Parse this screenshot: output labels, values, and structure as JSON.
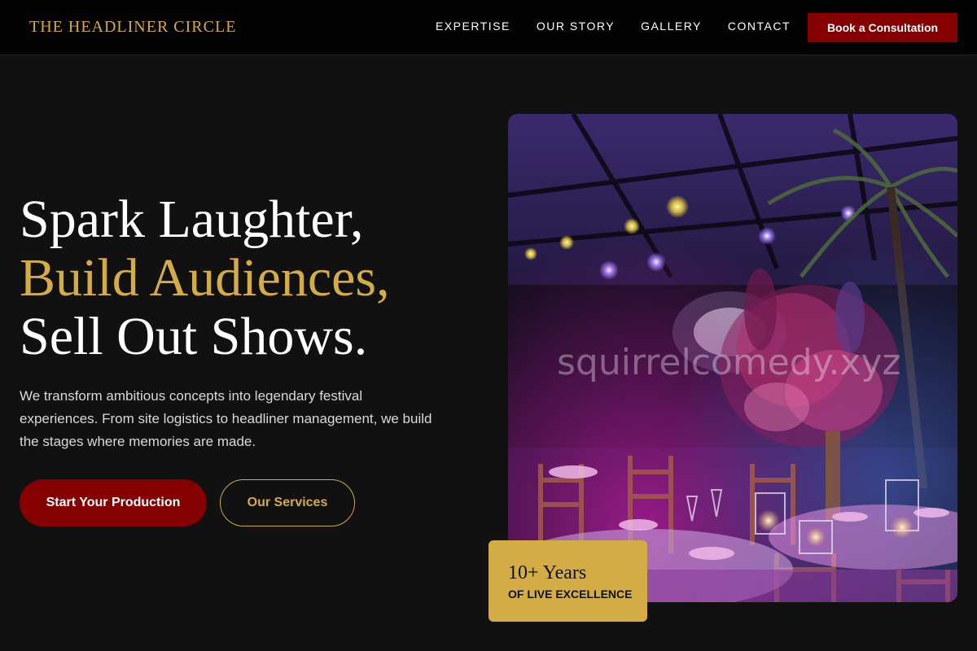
{
  "brand": {
    "name": "THE HEADLINER CIRCLE",
    "accent": "#d4ac45",
    "primary": "#850000"
  },
  "nav": {
    "items": [
      "EXPERTISE",
      "OUR STORY",
      "GALLERY",
      "CONTACT"
    ],
    "cta_label": "Book a Consultation"
  },
  "hero": {
    "headline_line1": "Spark Laughter,",
    "headline_line2": "Build Audiences,",
    "headline_line3": "Sell Out Shows.",
    "subtext": "We transform ambitious concepts into legendary festival experiences. From site logistics to headliner management, we build the stages where memories are made.",
    "primary_button": "Start Your Production",
    "secondary_button": "Our Services"
  },
  "image": {
    "watermark": "squirrelcomedy.xyz"
  },
  "badge": {
    "years": "10+ Years",
    "caption": "OF LIVE EXCELLENCE"
  }
}
